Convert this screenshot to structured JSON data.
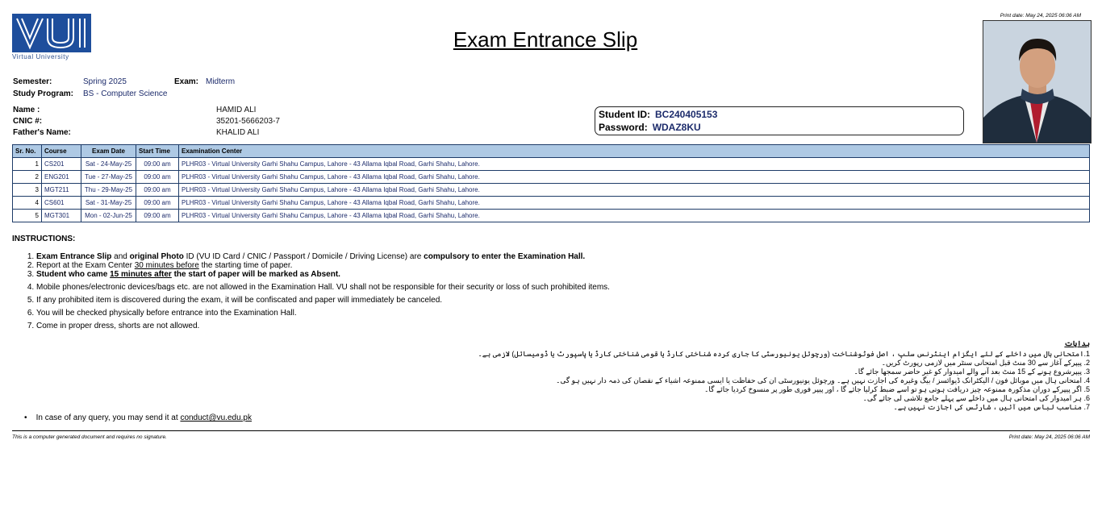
{
  "header": {
    "logo_text": "Virtual University",
    "title": "Exam Entrance Slip",
    "print_date": "Print date: May 24, 2025 06:06 AM"
  },
  "info": {
    "semester_label": "Semester:",
    "semester": "Spring 2025",
    "exam_label": "Exam:",
    "exam": "Midterm",
    "program_label": "Study Program:",
    "program": "BS - Computer Science",
    "name_label": "Name :",
    "name": "HAMID ALI",
    "cnic_label": "CNIC #:",
    "cnic": "35201-5666203-7",
    "father_label": "Father's Name:",
    "father": "KHALID ALI"
  },
  "credentials": {
    "id_label": "Student ID:",
    "id": "BC240405153",
    "pwd_label": "Password:",
    "pwd": "WDAZ8KU"
  },
  "schedule": {
    "headers": [
      "Sr. No.",
      "Course",
      "Exam Date",
      "Start Time",
      "Examination Center"
    ],
    "rows": [
      {
        "sr": "1",
        "course": "CS201",
        "date": "Sat - 24-May-25",
        "time": "09:00 am",
        "center": "PLHR03 - Virtual University Garhi Shahu Campus, Lahore - 43 Allama Iqbal Road, Garhi Shahu, Lahore."
      },
      {
        "sr": "2",
        "course": "ENG201",
        "date": "Tue - 27-May-25",
        "time": "09:00 am",
        "center": "PLHR03 - Virtual University Garhi Shahu Campus, Lahore - 43 Allama Iqbal Road, Garhi Shahu, Lahore."
      },
      {
        "sr": "3",
        "course": "MGT211",
        "date": "Thu - 29-May-25",
        "time": "09:00 am",
        "center": "PLHR03 - Virtual University Garhi Shahu Campus, Lahore - 43 Allama Iqbal Road, Garhi Shahu, Lahore."
      },
      {
        "sr": "4",
        "course": "CS601",
        "date": "Sat - 31-May-25",
        "time": "09:00 am",
        "center": "PLHR03 - Virtual University Garhi Shahu Campus, Lahore - 43 Allama Iqbal Road, Garhi Shahu, Lahore."
      },
      {
        "sr": "5",
        "course": "MGT301",
        "date": "Mon - 02-Jun-25",
        "time": "09:00 am",
        "center": "PLHR03 - Virtual University Garhi Shahu Campus, Lahore - 43 Allama Iqbal Road, Garhi Shahu, Lahore."
      }
    ]
  },
  "instructions": {
    "heading": "INSTRUCTIONS:",
    "i1_a": "Exam Entrance Slip",
    "i1_b": " and ",
    "i1_c": "original Photo",
    "i1_d": " ID (VU ID Card / CNIC / Passport / Domicile / Driving License) are ",
    "i1_e": "compulsory to enter the Examination Hall.",
    "i2_a": "Report at the Exam Center ",
    "i2_b": "30 minutes before",
    "i2_c": " the starting time of paper.",
    "i3_a": "Student who came ",
    "i3_b": "15 minutes after",
    "i3_c": " the start of paper will be marked as Absent.",
    "i4": "Mobile phones/electronic devices/bags etc. are not allowed in the Examination Hall. VU shall not be responsible for their security or loss of such prohibited items.",
    "i5": "If any prohibited item is discovered during the exam, it will be confiscated and paper will immediately be canceled.",
    "i6": "You will be checked physically before entrance into the Examination Hall.",
    "i7": "Come in proper dress, shorts are not allowed."
  },
  "urdu": {
    "heading": "ہدایات",
    "lines": [
      "1.امتحانی ہال میں داخلے کے لئے ایگزام اینٹرنس سلپ ، اصل فوٹوشناخت (ورچوئل یونیورسٹی کا جاری کردہ شناختی کارڈ یا قومی شناختی کارڈ یا پاسپورٹ یا ڈومیسائل) لازمی ہے۔",
      "2. پیپرکے آغاز سے 30 منٹ قبل امتحانی سنٹر میں لازمی رپورٹ کریں۔",
      "3. پیپرشروع ہونے کے 15 منٹ بعد آنے والے امیدوار کو غیر حاضر سمجھا جائے گا۔",
      "4. امتحانی ہال میں موبائل فون / الیکٹرانک ڈیوائسز / بیگ وغیرہ کی اجازت نہیں ہے۔ ورچوئل یونیورسٹی ان کی حفاظت یا ایسی ممنوعہ اشیاء کے نقصان کی ذمہ دار نہیں ہو گی۔",
      "5. اگر پیپرکے دوران مذکورہ ممنوعہ چیز دریافت ہوتی ہو تو اسے ضبط کرلیا جائے گا ، اور پیپر فوری طور پر منسوخ کردیا جائے گا۔",
      "6. ہر امیدوار کی امتحانی ہال میں داخلے سے پہلے جامع تلاشی لی جائے گی۔",
      "7. مناسب لباس میں آئیں ، شارٹس کی اجازت نہیں ہے۔"
    ]
  },
  "query": {
    "text": "In case of any query, you may send it at ",
    "email": "conduct@vu.edu.pk"
  },
  "footer": {
    "left": "This is a computer generated document and requires no signature.",
    "right": "Print date: May 24, 2025 06:06 AM"
  }
}
